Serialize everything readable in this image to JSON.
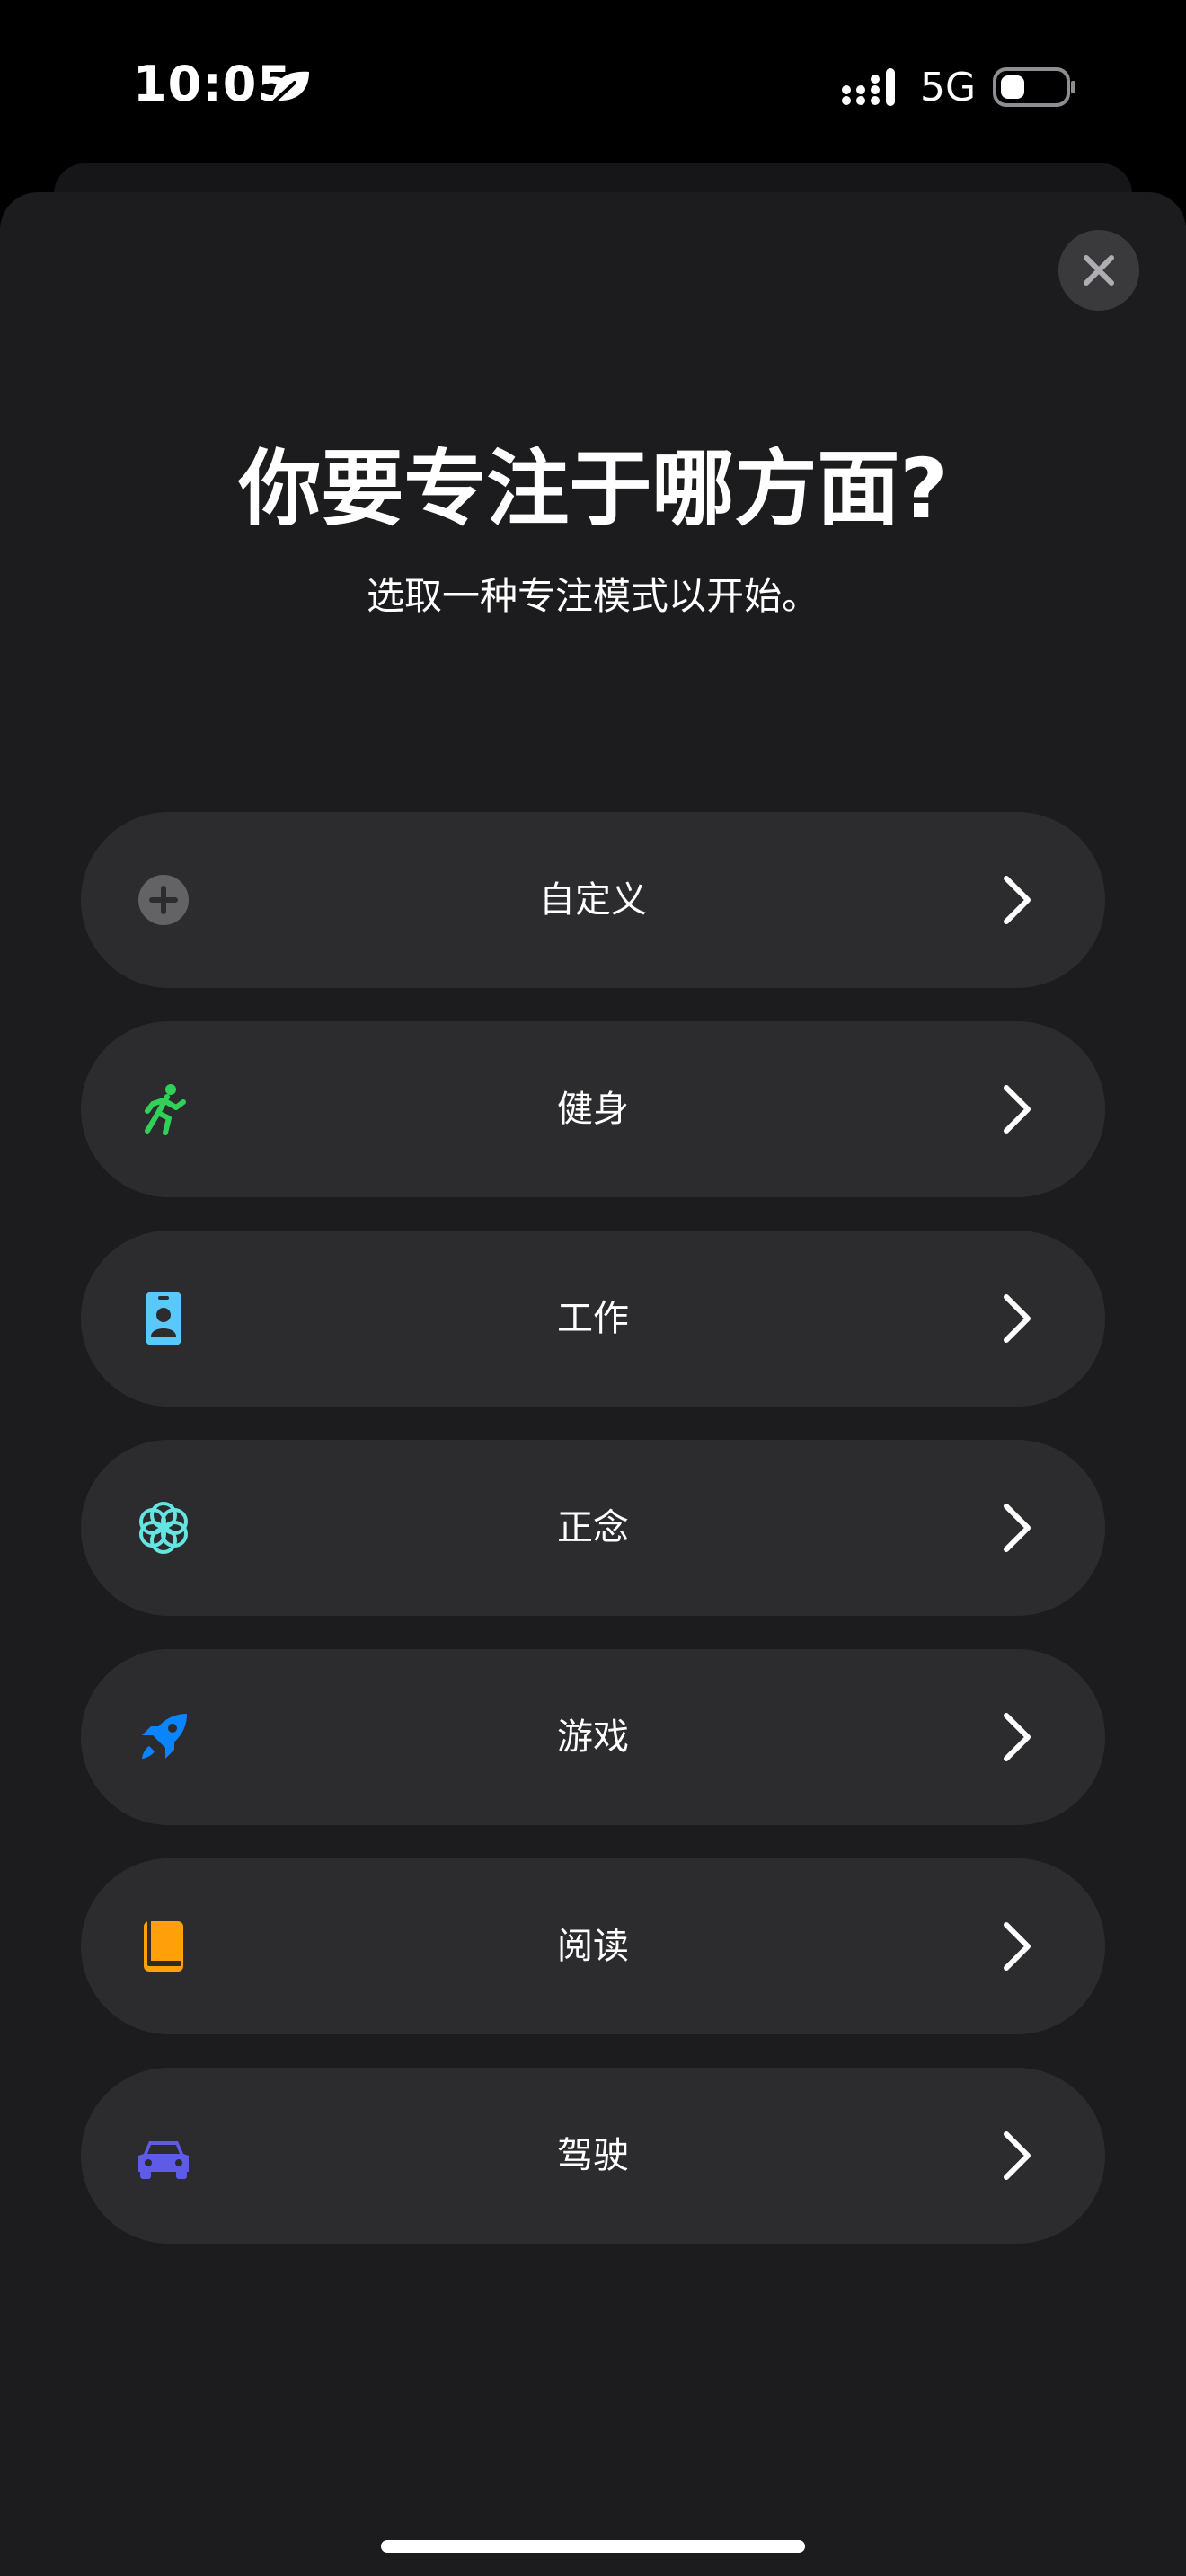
{
  "status_bar": {
    "time": "10:05",
    "network": "5G",
    "icons": [
      "leaf-icon",
      "signal-icon",
      "battery-icon"
    ]
  },
  "sheet": {
    "title": "你要专注于哪方面?",
    "subtitle": "选取一种专注模式以开始。",
    "close_icon": "close-icon"
  },
  "modes": [
    {
      "label": "自定义",
      "icon": "plus-circle-icon",
      "color": "#636366"
    },
    {
      "label": "健身",
      "icon": "running-figure-icon",
      "color": "#30d158"
    },
    {
      "label": "工作",
      "icon": "id-badge-icon",
      "color": "#5ac8fa"
    },
    {
      "label": "正念",
      "icon": "flower-icon",
      "color": "#63e6e2"
    },
    {
      "label": "游戏",
      "icon": "rocket-icon",
      "color": "#0a84ff"
    },
    {
      "label": "阅读",
      "icon": "book-icon",
      "color": "#ff9f0a"
    },
    {
      "label": "驾驶",
      "icon": "car-icon",
      "color": "#5e5ce6"
    }
  ],
  "colors": {
    "background": "#000000",
    "sheet": "#1c1c1e",
    "row": "#2c2c2e"
  }
}
